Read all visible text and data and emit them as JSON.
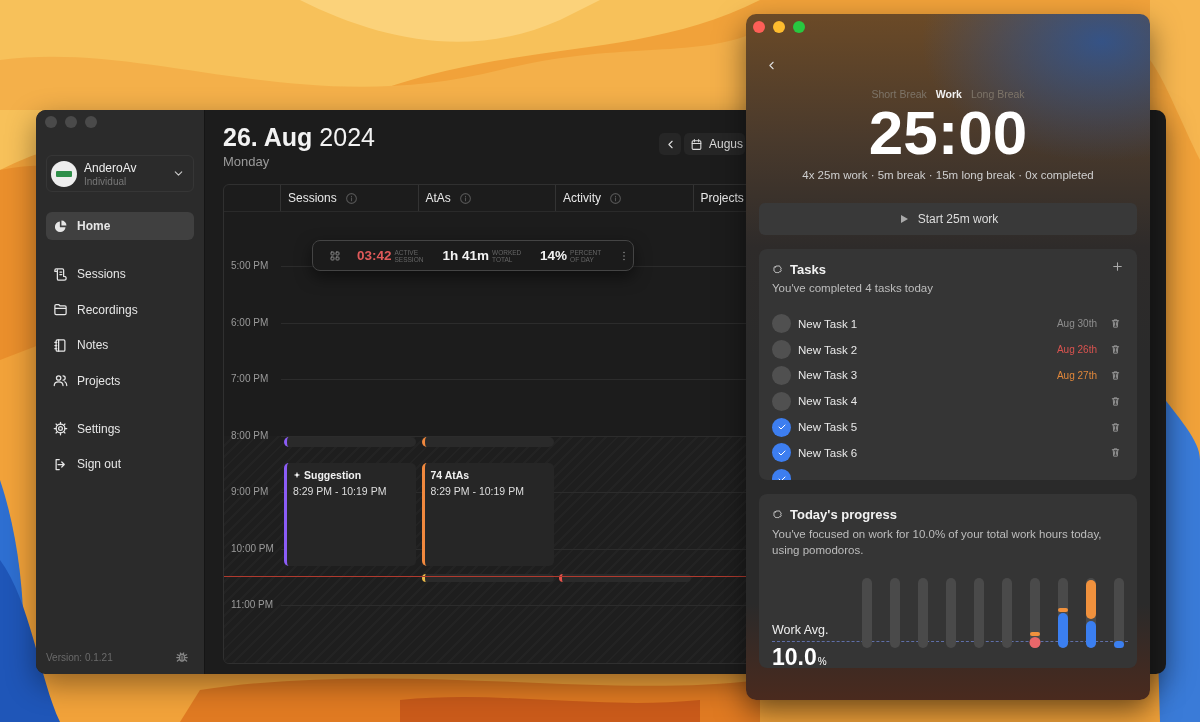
{
  "main_window": {
    "focused": false,
    "account": {
      "name": "AnderoAv",
      "plan": "Individual"
    },
    "nav_groups": [
      [
        {
          "label": "Home",
          "kind": "pie",
          "selected": true
        }
      ],
      [
        {
          "label": "Sessions",
          "kind": "scroll",
          "selected": false
        },
        {
          "label": "Recordings",
          "kind": "folder",
          "selected": false
        },
        {
          "label": "Notes",
          "kind": "notebook",
          "selected": false
        },
        {
          "label": "Projects",
          "kind": "people",
          "selected": false
        }
      ],
      [
        {
          "label": "Settings",
          "kind": "gear",
          "selected": false
        },
        {
          "label": "Sign out",
          "kind": "signout",
          "selected": false
        }
      ]
    ],
    "version": "Version: 0.1.21",
    "date": {
      "day": "26. Aug",
      "year": "2024",
      "weekday": "Monday"
    },
    "month_button": "Augus",
    "columns": [
      {
        "label": "Sessions",
        "info": true
      },
      {
        "label": "AtAs",
        "info": true
      },
      {
        "label": "Activity",
        "info": true
      },
      {
        "label": "Projects",
        "info": false
      }
    ],
    "time_labels": [
      "5:00 PM",
      "6:00 PM",
      "7:00 PM",
      "8:00 PM",
      "9:00 PM",
      "10:00 PM",
      "11:00 PM"
    ],
    "events": [
      {
        "kind": "collapsed",
        "color": "#8b5cf6"
      },
      {
        "kind": "collapsed",
        "color": "#f0883e"
      },
      {
        "kind": "block",
        "title": "Suggestion",
        "time": "8:29 PM - 10:19 PM",
        "color": "#8b5cf6",
        "sparkle": true
      },
      {
        "kind": "block",
        "title": "74 AtAs",
        "time": "8:29 PM - 10:19 PM",
        "color": "#f0883e",
        "sparkle": false
      },
      {
        "kind": "collapsed",
        "color": "#e9b949"
      },
      {
        "kind": "collapsed",
        "color": "#e5534b"
      }
    ],
    "stats": [
      {
        "value": "03:42",
        "label": "ACTIVE SESSION",
        "alert": true
      },
      {
        "value": "1h 41m",
        "label": "WORKED TOTAL",
        "alert": false
      },
      {
        "value": "14%",
        "label": "PERCENT OF DAY",
        "alert": false
      }
    ]
  },
  "pomodoro_window": {
    "focused": true,
    "modes": [
      {
        "label": "Short Break",
        "selected": false
      },
      {
        "label": "Work",
        "selected": true
      },
      {
        "label": "Long Break",
        "selected": false
      }
    ],
    "timer": "25:00",
    "summary": "4x 25m work · 5m break · 15m long break · 0x completed",
    "start_button": "Start 25m work",
    "tasks": {
      "title": "Tasks",
      "subtitle": "You've completed 4 tasks today",
      "items": [
        {
          "label": "New Task 1",
          "checked": false,
          "due": "Aug 30th",
          "color": "#8e8e8e"
        },
        {
          "label": "New Task 2",
          "checked": false,
          "due": "Aug 26th",
          "color": "#d9534f"
        },
        {
          "label": "New Task 3",
          "checked": false,
          "due": "Aug 27th",
          "color": "#e0873a"
        },
        {
          "label": "New Task 4",
          "checked": false
        },
        {
          "label": "New Task 5",
          "checked": true
        },
        {
          "label": "New Task 6",
          "checked": true
        },
        {
          "checked": true
        }
      ]
    },
    "progress": {
      "title": "Today's progress",
      "text": "You've focused on work for 10.0% of your total work hours today, using pomodoros.",
      "avg_label": "Work Avg.",
      "avg_value": "10.0",
      "avg_unit": "%"
    }
  }
}
